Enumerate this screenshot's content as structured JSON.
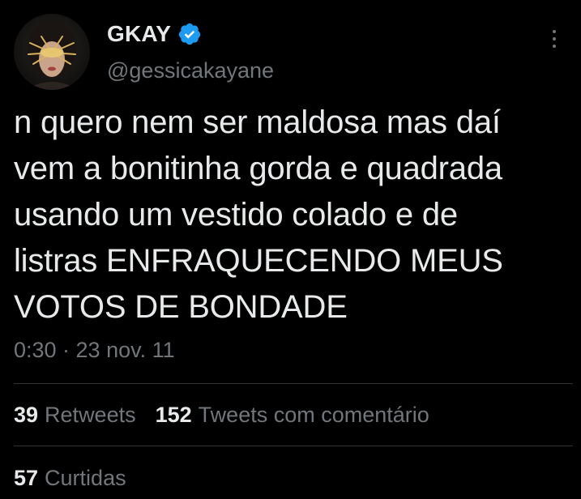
{
  "author": {
    "display_name": "GKAY",
    "handle": "@gessicakayane",
    "verified": true,
    "verified_color": "#1d9bf0",
    "avatar_icon": "profile-photo"
  },
  "tweet": {
    "text": "n quero nem ser maldosa mas daí\nvem a bonitinha gorda e quadrada\nusando um vestido colado e de\nlistras ENFRAQUECENDO MEUS\nVOTOS DE BONDADE",
    "timestamp": "0:30 · 23 nov. 11"
  },
  "stats": {
    "retweets_count": "39",
    "retweets_label": "Retweets",
    "quotes_count": "152",
    "quotes_label": "Tweets com comentário",
    "likes_count": "57",
    "likes_label": "Curtidas"
  },
  "more_icon": "more-vertical-icon",
  "colors": {
    "background": "#000000",
    "text_primary": "#e7e9ea",
    "text_secondary": "#71767b",
    "divider": "#2f3336"
  }
}
